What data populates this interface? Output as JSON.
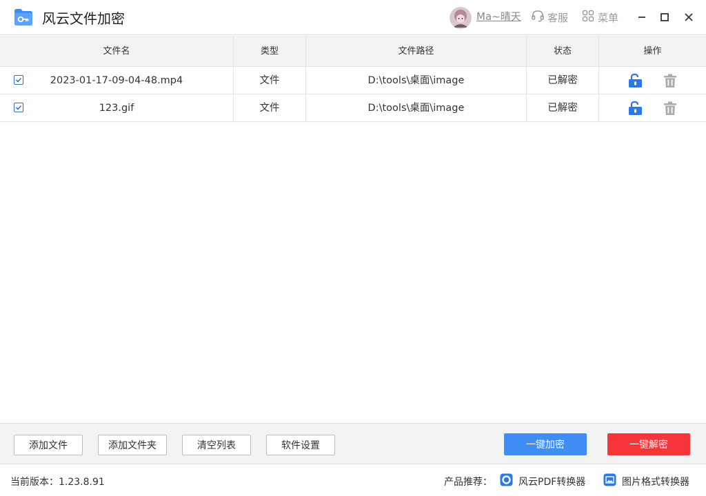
{
  "app": {
    "title": "风云文件加密",
    "username": "Ma~晴天",
    "service_label": "客服",
    "menu_label": "菜单"
  },
  "table": {
    "headers": {
      "name": "文件名",
      "type": "类型",
      "path": "文件路径",
      "status": "状态",
      "ops": "操作"
    },
    "rows": [
      {
        "checked": true,
        "name": "2023-01-17-09-04-48.mp4",
        "type": "文件",
        "path": "D:\\tools\\桌面\\image",
        "status": "已解密"
      },
      {
        "checked": true,
        "name": "123.gif",
        "type": "文件",
        "path": "D:\\tools\\桌面\\image",
        "status": "已解密"
      }
    ]
  },
  "toolbar": {
    "add_file": "添加文件",
    "add_folder": "添加文件夹",
    "clear_list": "清空列表",
    "settings": "软件设置",
    "encrypt_all": "一键加密",
    "decrypt_all": "一键解密"
  },
  "status": {
    "version_text": "当前版本：1.23.8.91",
    "recommend_label": "产品推荐：",
    "rec_pdf": "风云PDF转换器",
    "rec_image": "图片格式转换器"
  },
  "colors": {
    "accent_blue": "#3f8ef7",
    "accent_red": "#f5353a",
    "icon_gray": "#9a9a9a"
  },
  "icons": {
    "app": "folder-key-icon",
    "service": "headset-icon",
    "menu": "grid-icon",
    "unlock": "unlock-icon",
    "delete": "trash-icon"
  }
}
